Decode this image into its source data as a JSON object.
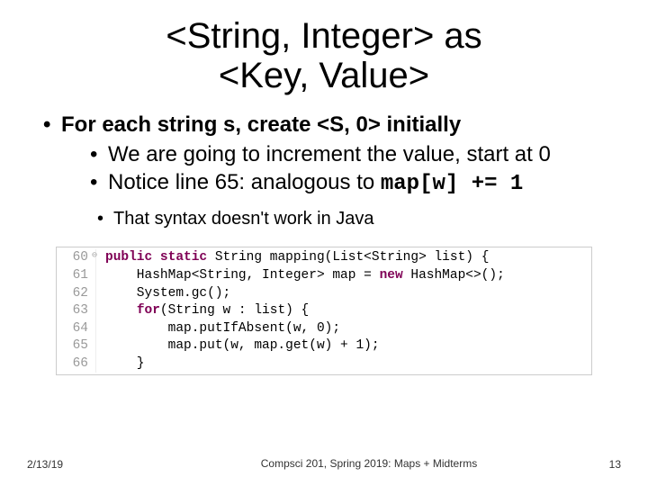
{
  "title_line1": "<String, Integer> as",
  "title_line2": "<Key, Value>",
  "bullets": {
    "b1": "For each string s, create <S, 0> initially",
    "b1a": "We are going to increment the value, start at 0",
    "b1b_pre": "Notice line 65: analogous to ",
    "b1b_code": "map[w] += 1",
    "b1c": "That syntax doesn't work in Java"
  },
  "code": {
    "lines": [
      "60",
      "61",
      "62",
      "63",
      "64",
      "65",
      "66"
    ],
    "l60_a": "public",
    "l60_b": " ",
    "l60_c": "static",
    "l60_d": " String mapping(List<String> list) {",
    "l61": "    HashMap<String, Integer> map = ",
    "l61_kw": "new",
    "l61_b": " HashMap<>();",
    "l62": "    System.gc();",
    "l63_a": "    ",
    "l63_kw": "for",
    "l63_b": "(String w : list) {",
    "l64": "        map.putIfAbsent(w, 0);",
    "l65": "        map.put(w, map.get(w) + 1);",
    "l66": "    }"
  },
  "footer": {
    "date": "2/13/19",
    "mid": "Compsci 201, Spring 2019:  Maps + Midterms",
    "page": "13"
  }
}
